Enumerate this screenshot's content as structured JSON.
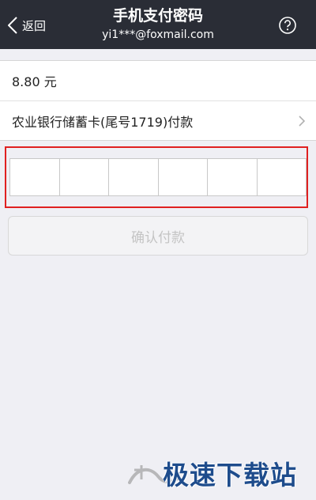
{
  "header": {
    "back_label": "返回",
    "title": "手机支付密码",
    "account": "yi1***@foxmail.com",
    "help_icon": "help-icon",
    "background": "#2a2d36"
  },
  "order": {
    "amount": "8.80 元",
    "payment_method": "农业银行储蓄卡(尾号1719)付款"
  },
  "password": {
    "digit_count": 6,
    "highlight_color": "#e02020"
  },
  "confirm_button": {
    "label": "确认付款",
    "enabled": false
  },
  "watermark": {
    "text": "极速下载站"
  }
}
